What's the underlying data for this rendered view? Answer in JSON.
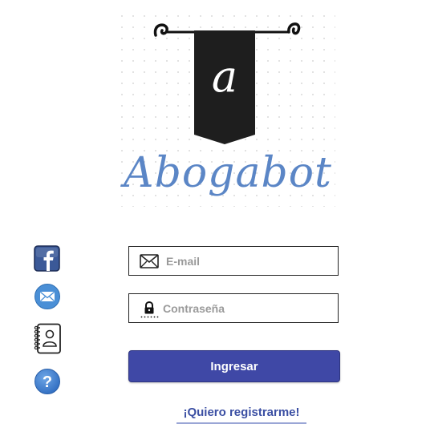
{
  "brand": {
    "name": "Abogabot",
    "monogram": "a"
  },
  "sidebar": {
    "items": [
      {
        "icon": "facebook-icon",
        "color": "#3b5998"
      },
      {
        "icon": "mail-icon",
        "color": "#4a8fd6"
      },
      {
        "icon": "contacts-book-icon",
        "color": "#222222"
      },
      {
        "icon": "help-icon",
        "color": "#3d7fcf",
        "glyph": "?"
      }
    ]
  },
  "form": {
    "email_placeholder": "E-mail",
    "password_placeholder": "Contraseña",
    "submit_label": "Ingresar",
    "register_label": "¡Quiero registrarme!"
  },
  "colors": {
    "primary": "#3f48a6",
    "link": "#3b4fa3",
    "brand_text": "#5b86c6",
    "banner": "#1e1e1e"
  }
}
